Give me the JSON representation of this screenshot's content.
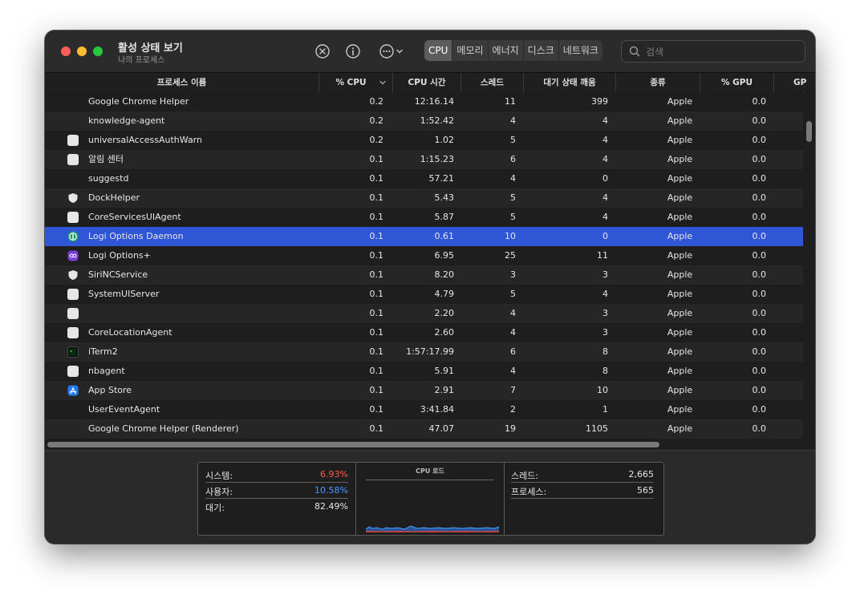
{
  "window": {
    "title": "활성 상태 보기",
    "subtitle": "나의 프로세스"
  },
  "toolbar": {
    "stop_icon": "x-circle-icon",
    "info_icon": "info-icon",
    "more_icon": "ellipsis-circle-icon",
    "tabs": [
      {
        "label": "CPU",
        "active": true
      },
      {
        "label": "메모리",
        "active": false
      },
      {
        "label": "에너지",
        "active": false
      },
      {
        "label": "디스크",
        "active": false
      },
      {
        "label": "네트워크",
        "active": false
      }
    ],
    "search_placeholder": "검색"
  },
  "table": {
    "columns": [
      "프로세스 이름",
      "% CPU",
      "CPU 시간",
      "스레드",
      "대기 상태 깨움",
      "종류",
      "% GPU",
      "GP"
    ],
    "sort_column": "% CPU",
    "rows": [
      {
        "name": "Google Chrome Helper",
        "icon": "none",
        "cpu": "0.2",
        "time": "12:16.14",
        "threads": "11",
        "wakes": "399",
        "kind": "Apple",
        "gpu": "0.0"
      },
      {
        "name": "knowledge-agent",
        "icon": "none",
        "cpu": "0.2",
        "time": "1:52.42",
        "threads": "4",
        "wakes": "4",
        "kind": "Apple",
        "gpu": "0.0"
      },
      {
        "name": "universalAccessAuthWarn",
        "icon": "generic-app-icon",
        "cpu": "0.2",
        "time": "1.02",
        "threads": "5",
        "wakes": "4",
        "kind": "Apple",
        "gpu": "0.0"
      },
      {
        "name": "알림 센터",
        "icon": "generic-app-icon",
        "cpu": "0.1",
        "time": "1:15.23",
        "threads": "6",
        "wakes": "4",
        "kind": "Apple",
        "gpu": "0.0"
      },
      {
        "name": "suggestd",
        "icon": "none",
        "cpu": "0.1",
        "time": "57.21",
        "threads": "4",
        "wakes": "0",
        "kind": "Apple",
        "gpu": "0.0"
      },
      {
        "name": "DockHelper",
        "icon": "shield-icon",
        "cpu": "0.1",
        "time": "5.43",
        "threads": "5",
        "wakes": "4",
        "kind": "Apple",
        "gpu": "0.0"
      },
      {
        "name": "CoreServicesUIAgent",
        "icon": "generic-app-icon",
        "cpu": "0.1",
        "time": "5.87",
        "threads": "5",
        "wakes": "4",
        "kind": "Apple",
        "gpu": "0.0"
      },
      {
        "name": "Logi Options Daemon",
        "icon": "logi-daemon-icon",
        "cpu": "0.1",
        "time": "0.61",
        "threads": "10",
        "wakes": "0",
        "kind": "Apple",
        "gpu": "0.0",
        "selected": true
      },
      {
        "name": "Logi Options+",
        "icon": "logi-options-icon",
        "cpu": "0.1",
        "time": "6.95",
        "threads": "25",
        "wakes": "11",
        "kind": "Apple",
        "gpu": "0.0"
      },
      {
        "name": "SiriNCService",
        "icon": "shield-icon",
        "cpu": "0.1",
        "time": "8.20",
        "threads": "3",
        "wakes": "3",
        "kind": "Apple",
        "gpu": "0.0"
      },
      {
        "name": "SystemUIServer",
        "icon": "generic-app-icon",
        "cpu": "0.1",
        "time": "4.79",
        "threads": "5",
        "wakes": "4",
        "kind": "Apple",
        "gpu": "0.0"
      },
      {
        "name": "",
        "icon": "generic-app-icon",
        "cpu": "0.1",
        "time": "2.20",
        "threads": "4",
        "wakes": "3",
        "kind": "Apple",
        "gpu": "0.0"
      },
      {
        "name": "CoreLocationAgent",
        "icon": "generic-app-icon",
        "cpu": "0.1",
        "time": "2.60",
        "threads": "4",
        "wakes": "3",
        "kind": "Apple",
        "gpu": "0.0"
      },
      {
        "name": "iTerm2",
        "icon": "terminal-icon",
        "cpu": "0.1",
        "time": "1:57:17.99",
        "threads": "6",
        "wakes": "8",
        "kind": "Apple",
        "gpu": "0.0"
      },
      {
        "name": "nbagent",
        "icon": "generic-app-icon",
        "cpu": "0.1",
        "time": "5.91",
        "threads": "4",
        "wakes": "8",
        "kind": "Apple",
        "gpu": "0.0"
      },
      {
        "name": "App Store",
        "icon": "app-store-icon",
        "cpu": "0.1",
        "time": "2.91",
        "threads": "7",
        "wakes": "10",
        "kind": "Apple",
        "gpu": "0.0"
      },
      {
        "name": "UserEventAgent",
        "icon": "none",
        "cpu": "0.1",
        "time": "3:41.84",
        "threads": "2",
        "wakes": "1",
        "kind": "Apple",
        "gpu": "0.0"
      },
      {
        "name": "Google Chrome Helper (Renderer)",
        "icon": "none",
        "cpu": "0.1",
        "time": "47.07",
        "threads": "19",
        "wakes": "1105",
        "kind": "Apple",
        "gpu": "0.0"
      }
    ]
  },
  "summary": {
    "left": [
      {
        "label": "시스템:",
        "value": "6.93%",
        "color": "#ff5a4e"
      },
      {
        "label": "사용자:",
        "value": "10.58%",
        "color": "#4a9cff"
      },
      {
        "label": "대기:",
        "value": "82.49%",
        "color": "#e6e6e6"
      }
    ],
    "chart_title": "CPU 로드",
    "right": [
      {
        "label": "스레드:",
        "value": "2,665"
      },
      {
        "label": "프로세스:",
        "value": "565"
      }
    ]
  },
  "colors": {
    "selection": "#2f56d4",
    "system_load": "#ff5a4e",
    "user_load": "#4a9cff"
  }
}
